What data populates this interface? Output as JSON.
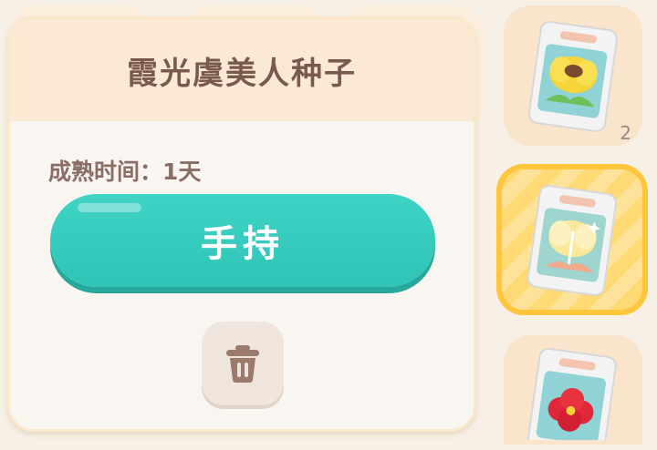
{
  "popup": {
    "title": "霞光虞美人种子",
    "mature_label": "成熟时间：",
    "mature_value": "1天",
    "hold_button_label": "手持",
    "delete_icon": "trash-icon"
  },
  "inventory": {
    "slots": [
      {
        "item": "yellow-flower-seed-pack",
        "count": "2",
        "selected": false
      },
      {
        "item": "pale-yellow-flower-seed-pack",
        "count": "",
        "selected": true
      },
      {
        "item": "red-flower-seed-pack",
        "count": "",
        "selected": false
      }
    ]
  },
  "colors": {
    "accent_teal": "#34c9bb",
    "selected_gold": "#ffc53b",
    "title_brown": "#7a5a4e",
    "header_cream": "#fbe9d3"
  }
}
